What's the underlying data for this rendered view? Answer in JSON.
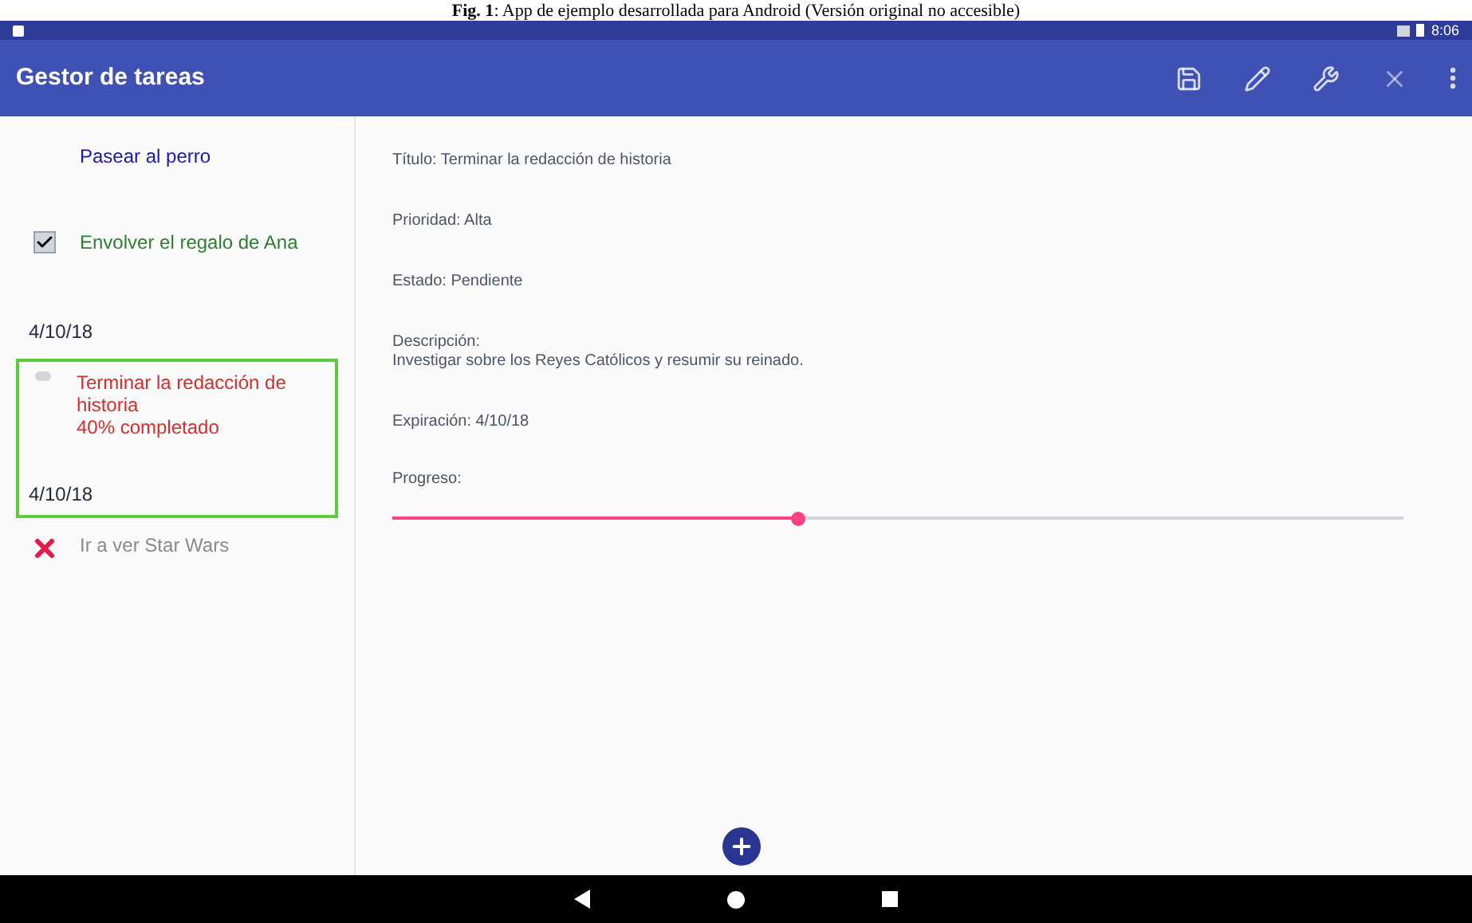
{
  "caption": "**Fig. 1**: App de ejemplo desarrollada para Android (Versión original no accesible)",
  "status_bar": {
    "time": "8:06"
  },
  "app_bar": {
    "title": "Gestor de tareas"
  },
  "tasks": [
    {
      "title": "Pasear al perro",
      "color": "#1a1aa6",
      "kind": "none",
      "selected": false
    },
    {
      "title": "Envolver el regalo de Ana",
      "color": "#2e7d32",
      "kind": "done",
      "date": "4/10/18",
      "selected": false
    },
    {
      "title": "Terminar la redacción de historia",
      "progress": "40% completado",
      "color": "#d32f2f",
      "kind": "progress",
      "date": "4/10/18",
      "selected": true
    },
    {
      "title": "Ir a ver Star Wars",
      "color": "#8a8a8a",
      "kind": "cancelled",
      "selected": false
    }
  ],
  "details": [
    {
      "label": "Título:",
      "value": "Terminar la redacción de historia"
    },
    {
      "label": "Prioridad:",
      "value": "Alta"
    },
    {
      "label": "Estado:",
      "value": "Pendiente"
    },
    {
      "label": "Descripción:",
      "value": "Investigar sobre los Reyes Católicos y resumir su reinado.",
      "multiline": true
    },
    {
      "label": "Expiración:",
      "value": "4/10/18"
    }
  ],
  "progress": {
    "label": "Progreso:",
    "level": 0.4
  }
}
